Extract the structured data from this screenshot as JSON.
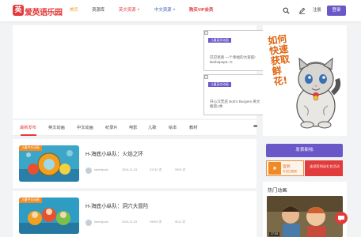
{
  "header": {
    "logo_text": "爱英语乐园",
    "logo_mark": "英",
    "nav": [
      {
        "label": "首页"
      },
      {
        "label": "资源库"
      },
      {
        "label": "英文资源"
      },
      {
        "label": "中文资源"
      },
      {
        "label": "购买VIP会员"
      }
    ],
    "register": "注册",
    "login": "登录"
  },
  "banner": {
    "thumbs": [
      {
        "tag": "儿童英文动画",
        "caption": "巴巴爸爸 一个幸福的大家庭! Barbapapa: O"
      },
      {
        "tag": "儿童英文动画",
        "caption": "开心汉堡店 Bob's Burgers 英文版第1季"
      }
    ]
  },
  "ad": {
    "text": "如何快速获取鲜花!"
  },
  "tabs": [
    "最新发布",
    "英文动画",
    "中文动画",
    "纪录片",
    "电影",
    "儿歌",
    "绘本",
    "教材"
  ],
  "tabs_more": "•••",
  "items": [
    {
      "tag": "儿童中文动画",
      "title": "H-海底小纵队：火焰之环",
      "author": "Iamhbpolo",
      "date": "2024-11-23",
      "views": "31742 次",
      "comments": "9390 次"
    },
    {
      "tag": "儿童中文动画",
      "title": "H-海底小纵队：洞穴大冒险",
      "author": "Iamhbpolo",
      "date": "2024-11-23",
      "views": "29992 次",
      "comments": "9011 次"
    }
  ],
  "sidebar": {
    "publish": "发表新帖",
    "signin_title": "签到",
    "signin_sub": "今日已签到",
    "checkin_text": "连续签到送礼包活动",
    "hot_title": "热门动画",
    "hot_time": "17:33"
  },
  "colors": {
    "accent": "#6b58c8",
    "brand": "#e23b3b",
    "active": "#f0a020"
  }
}
